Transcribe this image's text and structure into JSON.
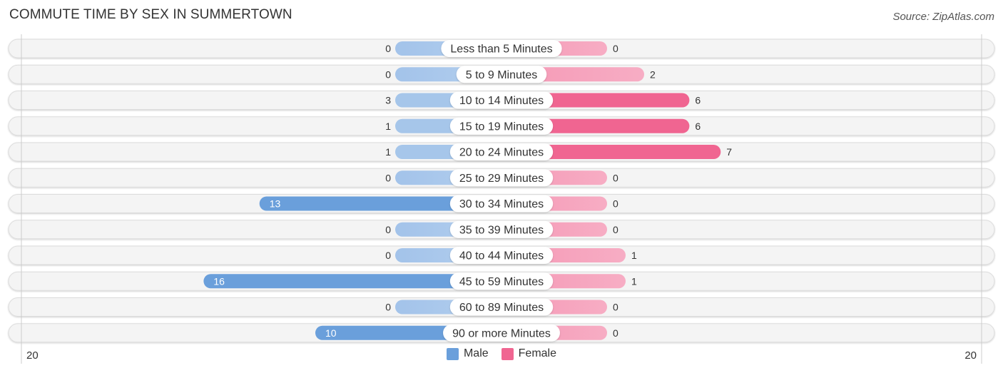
{
  "title": "COMMUTE TIME BY SEX IN SUMMERTOWN",
  "source": "Source: ZipAtlas.com",
  "legend": [
    {
      "name": "Male",
      "color": "#6a9fdb"
    },
    {
      "name": "Female",
      "color": "#f06591"
    }
  ],
  "colors": {
    "male_strong": "#6a9fdb",
    "male_light": "#a9c8ec",
    "female_strong": "#f06591",
    "female_light": "#f7a6bf",
    "row_bg": "#f3f3f3"
  },
  "chart_data": {
    "type": "bar",
    "orientation": "horizontal-diverging",
    "title": "COMMUTE TIME BY SEX IN SUMMERTOWN",
    "categories": [
      "Less than 5 Minutes",
      "5 to 9 Minutes",
      "10 to 14 Minutes",
      "15 to 19 Minutes",
      "20 to 24 Minutes",
      "25 to 29 Minutes",
      "30 to 34 Minutes",
      "35 to 39 Minutes",
      "40 to 44 Minutes",
      "45 to 59 Minutes",
      "60 to 89 Minutes",
      "90 or more Minutes"
    ],
    "series": [
      {
        "name": "Male",
        "values": [
          0,
          0,
          3,
          1,
          1,
          0,
          13,
          0,
          0,
          16,
          0,
          10
        ]
      },
      {
        "name": "Female",
        "values": [
          0,
          2,
          6,
          6,
          7,
          0,
          0,
          0,
          1,
          1,
          0,
          0
        ]
      }
    ],
    "axis": {
      "left_label": "20",
      "right_label": "20",
      "max": 20
    },
    "legend_position": "bottom-center",
    "grid": false
  }
}
